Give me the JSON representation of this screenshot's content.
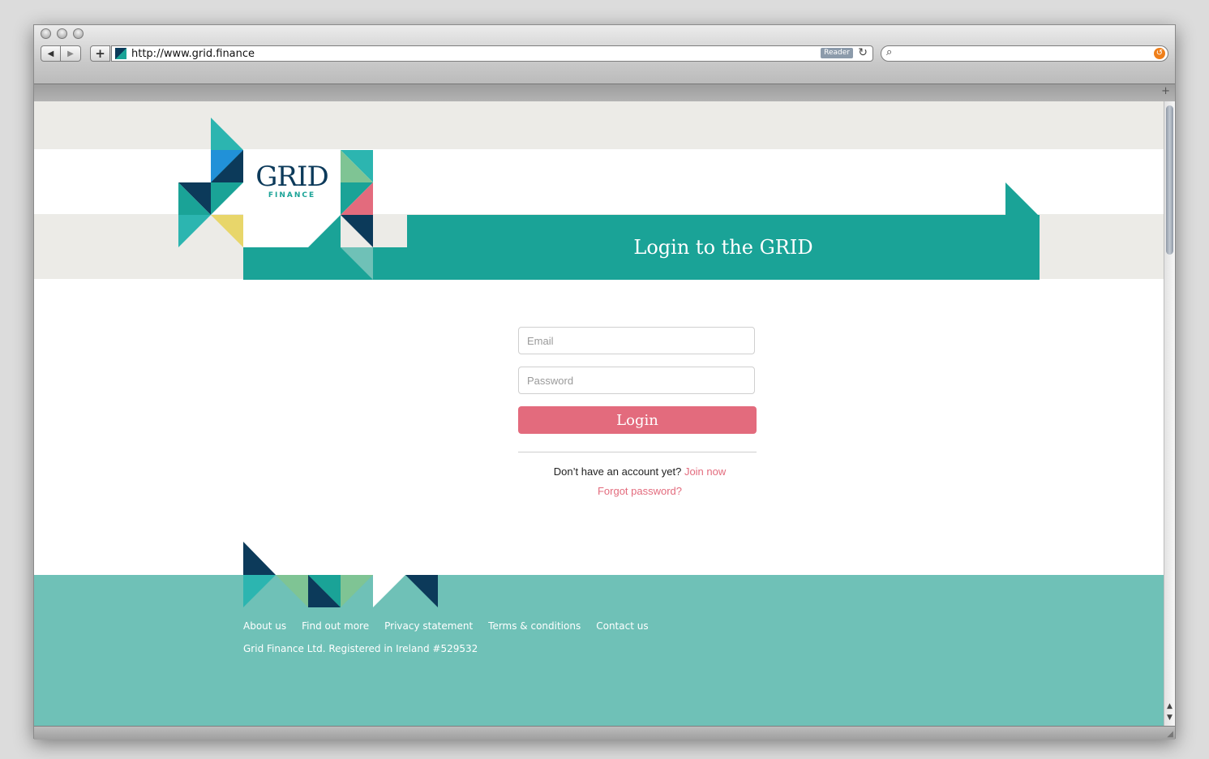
{
  "browser": {
    "url": "http://www.grid.finance",
    "reader_label": "Reader",
    "back_glyph": "◀",
    "forward_glyph": "▶",
    "add_glyph": "+",
    "reload_glyph": "↻",
    "search_glyph": "⌕",
    "newtab_glyph": "+",
    "snapback_glyph": "↺"
  },
  "brand": {
    "name": "GRID",
    "tagline": "FINANCE",
    "colors": {
      "teal": "#1aa397",
      "light_teal": "#6fc1b7",
      "navy": "#0c3a5a",
      "pink": "#e36b7d",
      "yellow": "#e8d66a",
      "blue": "#2191d8",
      "green": "#7fc494",
      "grey": "#ecebe7"
    }
  },
  "page": {
    "title": "Login to the GRID"
  },
  "form": {
    "email_placeholder": "Email",
    "password_placeholder": "Password",
    "login_label": "Login",
    "signup_prompt": "Don’t have an account yet?",
    "join_label": "Join now",
    "forgot_label": "Forgot password?"
  },
  "footer": {
    "links": [
      "About us",
      "Find out more",
      "Privacy statement",
      "Terms & conditions",
      "Contact us"
    ],
    "copyright": "Grid Finance Ltd. Registered in Ireland #529532"
  }
}
